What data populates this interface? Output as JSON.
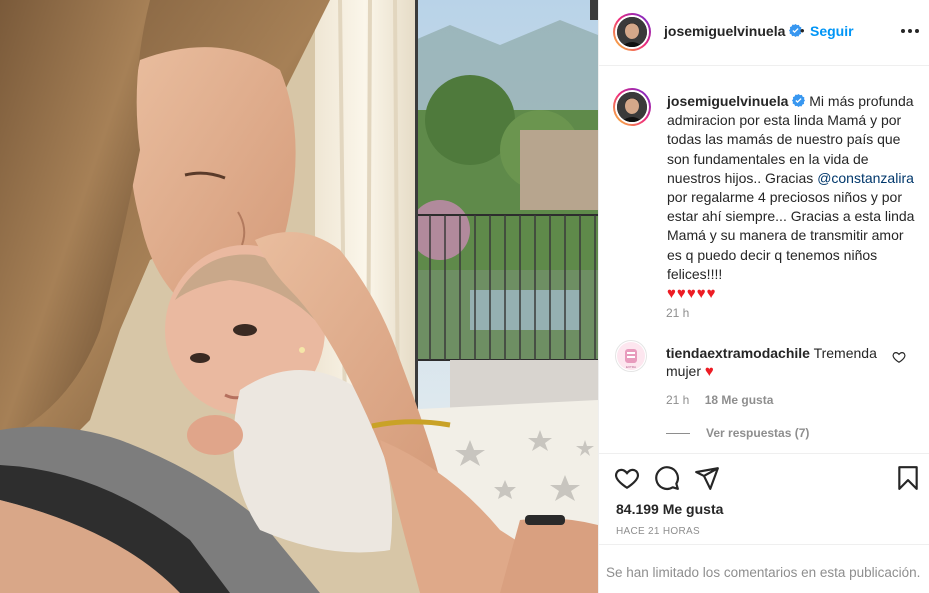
{
  "post": {
    "username": "josemiguelvinuela",
    "follow_label": "Seguir",
    "dot": "•"
  },
  "caption": {
    "username": "josemiguelvinuela",
    "text_before_mention": "Mi más profunda admiracion por esta linda Mamá y por todas las mamás de nuestro país que son fundamentales en la vida de nuestros hijos.. Gracias",
    "mention": "@constanzalira",
    "text_after_mention": "por regalarme 4 preciosos niños y por estar ahí siempre... Gracias a esta linda Mamá y su manera de transmitir amor es q puedo decir q tenemos niños felices!!!!",
    "hearts": "♥♥♥♥♥",
    "time": "21 h"
  },
  "comment": {
    "username": "tiendaextramodachile",
    "text": "Tremenda mujer",
    "heart": "♥",
    "time": "21 h",
    "likes": "18 Me gusta",
    "replies_label": "Ver respuestas (7)"
  },
  "actions": {
    "likes_count": "84.199 Me gusta",
    "posted": "HACE 21 HORAS"
  },
  "footer": {
    "limited_text": "Se han limitado los comentarios en esta publicación."
  },
  "icons": [
    "more-icon",
    "verified-icon",
    "heart-icon",
    "comment-icon",
    "share-icon",
    "bookmark-icon"
  ],
  "colors": {
    "link": "#0095f6",
    "mention": "#00376b",
    "muted": "#8e8e8e",
    "heart": "#ed1c24"
  }
}
